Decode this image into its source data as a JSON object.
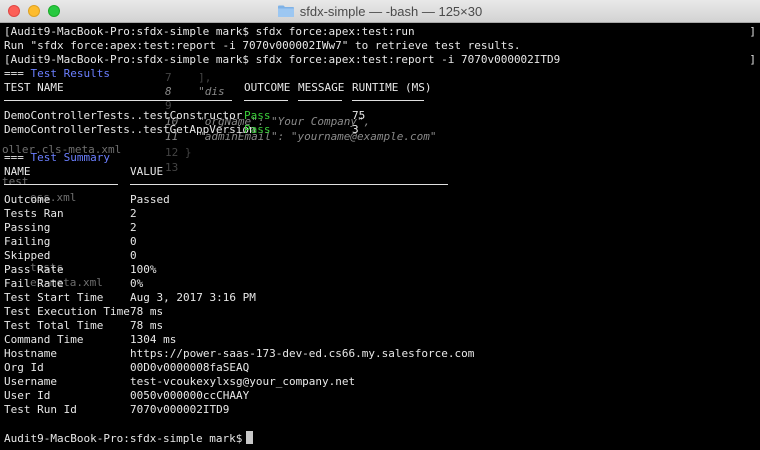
{
  "window": {
    "title": "sfdx-simple — -bash — 125×30"
  },
  "terminal": {
    "cmd1": "Audit9-MacBook-Pro:sfdx-simple mark$ sfdx force:apex:test:run",
    "msg1": "Run \"sfdx force:apex:test:report -i 7070v000002IWw7\" to retrieve test results.",
    "cmd2": "Audit9-MacBook-Pro:sfdx-simple mark$ sfdx force:apex:test:report -i 7070v000002ITD9",
    "results_header_prefix": "=== ",
    "results_header": "Test Results",
    "results_columns": {
      "test_name": "TEST NAME",
      "outcome": "OUTCOME",
      "message": "MESSAGE",
      "runtime": "RUNTIME (MS)"
    },
    "results_rows": [
      {
        "name": "DemoControllerTests..testConstructor",
        "outcome": "Pass",
        "message": "",
        "runtime": "75"
      },
      {
        "name": "DemoControllerTests..testGetAppVersion",
        "outcome": "Pass",
        "message": "",
        "runtime": "3"
      }
    ],
    "summary_header_prefix": "=== ",
    "summary_header": "Test Summary",
    "summary_columns": {
      "name": "NAME",
      "value": "VALUE"
    },
    "summary_rows": [
      {
        "name": "Outcome",
        "value": "Passed"
      },
      {
        "name": "Tests Ran",
        "value": "2"
      },
      {
        "name": "Passing",
        "value": "2"
      },
      {
        "name": "Failing",
        "value": "0"
      },
      {
        "name": "Skipped",
        "value": "0"
      },
      {
        "name": "Pass Rate",
        "value": "100%"
      },
      {
        "name": "Fail Rate",
        "value": "0%"
      },
      {
        "name": "Test Start Time",
        "value": "Aug 3, 2017 3:16 PM"
      },
      {
        "name": "Test Execution Time",
        "value": "78 ms"
      },
      {
        "name": "Test Total Time",
        "value": "78 ms"
      },
      {
        "name": "Command Time",
        "value": "1304 ms"
      },
      {
        "name": "Hostname",
        "value": "https://power-saas-173-dev-ed.cs66.my.salesforce.com"
      },
      {
        "name": "Org Id",
        "value": "00D0v0000008faSEAQ"
      },
      {
        "name": "Username",
        "value": "test-vcoukexylxsg@your_company.net"
      },
      {
        "name": "User Id",
        "value": "0050v000000ccCHAAY"
      },
      {
        "name": "Test Run Id",
        "value": "7070v000002ITD9"
      }
    ],
    "prompt": "Audit9-MacBook-Pro:sfdx-simple mark$"
  },
  "ghost_text": {
    "g1": "7    ],",
    "g2": "8    \"dis",
    "g3": "9",
    "g4": "10   \"orgName\": \"Your Company\",",
    "g5": "11   \"adminEmail\": \"yourname@example.com\"",
    "g6": "12 }",
    "g7": "13",
    "g8": "oller.cls-meta.xml",
    "g9": "test",
    "g10": "ess.xml",
    "g11": "es-meta.xml",
    "g12": "tests"
  },
  "colors": {
    "background": "#000000",
    "text": "#e8e8e8",
    "header_blue": "#6b7fff",
    "pass_green": "#3bd13b"
  }
}
